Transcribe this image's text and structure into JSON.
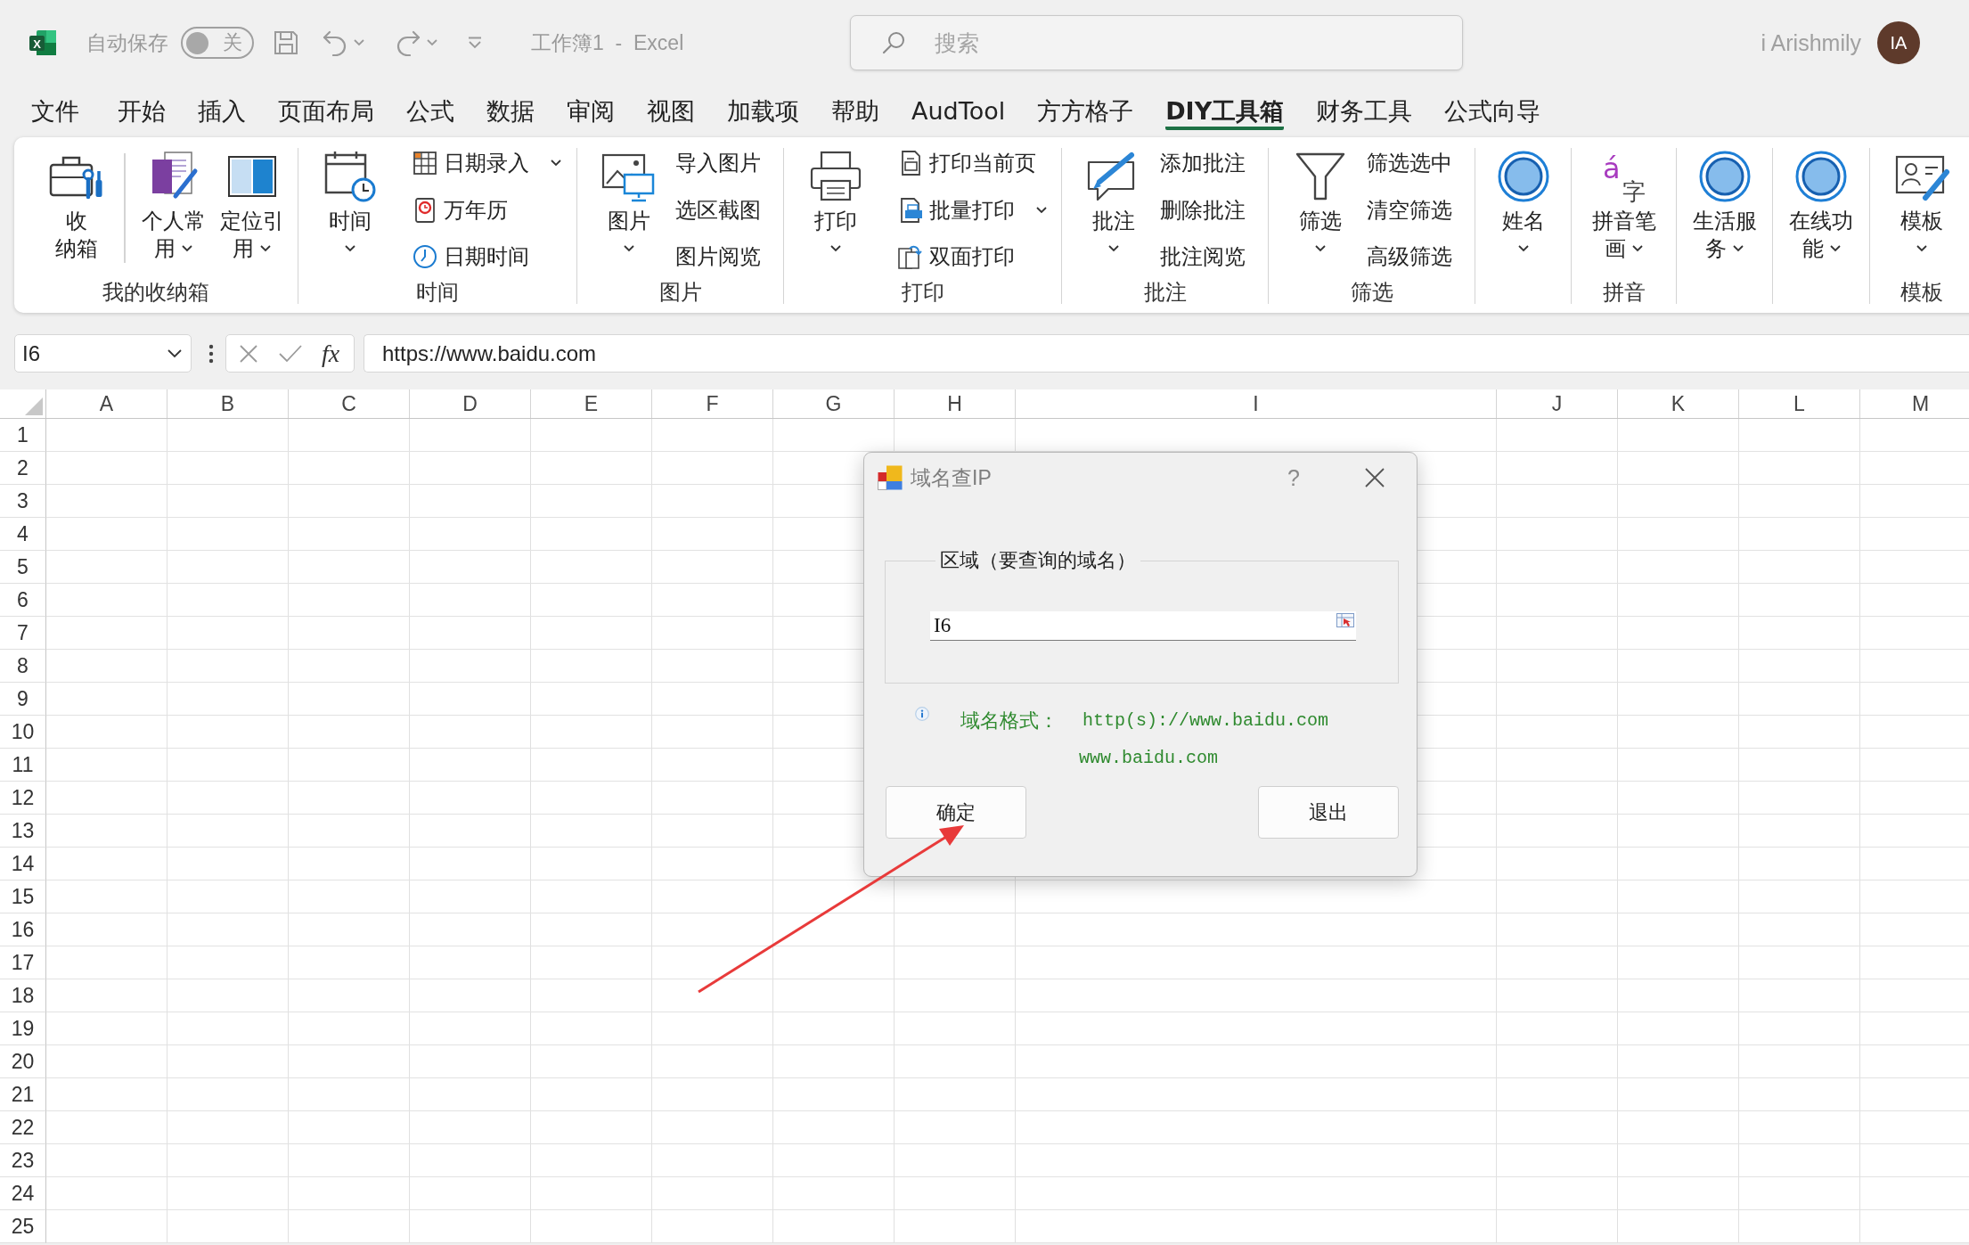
{
  "title_bar": {
    "logo_letter": "X",
    "autosave_label": "自动保存",
    "autosave_toggle": {
      "on": false,
      "label": "关"
    },
    "document_title": "工作簿1  -  Excel",
    "search": {
      "placeholder": "搜索"
    },
    "user_name": "i Arishmily",
    "avatar_initials": "IA"
  },
  "tabs": [
    {
      "label": "文件",
      "selected": false
    },
    {
      "label": "开始",
      "selected": false
    },
    {
      "label": "插入",
      "selected": false
    },
    {
      "label": "页面布局",
      "selected": false
    },
    {
      "label": "公式",
      "selected": false
    },
    {
      "label": "数据",
      "selected": false
    },
    {
      "label": "审阅",
      "selected": false
    },
    {
      "label": "视图",
      "selected": false
    },
    {
      "label": "加载项",
      "selected": false
    },
    {
      "label": "帮助",
      "selected": false
    },
    {
      "label": "AudTool",
      "selected": false
    },
    {
      "label": "方方格子",
      "selected": false
    },
    {
      "label": "DIY工具箱",
      "selected": true
    },
    {
      "label": "财务工具",
      "selected": false
    },
    {
      "label": "公式向导",
      "selected": false
    }
  ],
  "ribbon": {
    "groups": [
      {
        "label": "我的收纳箱",
        "items": [
          {
            "kind": "large",
            "lines": [
              "收",
              "纳箱"
            ],
            "dropdown": false
          },
          {
            "kind": "separator"
          },
          {
            "kind": "large",
            "lines": [
              "个人常",
              "用"
            ],
            "dropdown": true
          },
          {
            "kind": "large",
            "lines": [
              "定位引",
              "用"
            ],
            "dropdown": true
          }
        ]
      },
      {
        "label": "时间",
        "items": [
          {
            "kind": "large",
            "lines": [
              "时间"
            ],
            "dropdown": true
          },
          {
            "kind": "stack",
            "buttons": [
              {
                "label": "日期录入",
                "dropdown": true
              },
              {
                "label": "万年历",
                "dropdown": false
              },
              {
                "label": "日期时间",
                "dropdown": false
              }
            ]
          }
        ]
      },
      {
        "label": "图片",
        "items": [
          {
            "kind": "large",
            "lines": [
              "图片"
            ],
            "dropdown": true
          },
          {
            "kind": "stack",
            "buttons": [
              {
                "label": "导入图片",
                "dropdown": false
              },
              {
                "label": "选区截图",
                "dropdown": false
              },
              {
                "label": "图片阅览",
                "dropdown": false
              }
            ]
          }
        ]
      },
      {
        "label": "打印",
        "items": [
          {
            "kind": "large",
            "lines": [
              "打印"
            ],
            "dropdown": true
          },
          {
            "kind": "stack",
            "buttons": [
              {
                "label": "打印当前页",
                "dropdown": false
              },
              {
                "label": "批量打印",
                "dropdown": true
              },
              {
                "label": "双面打印",
                "dropdown": false
              }
            ]
          }
        ]
      },
      {
        "label": "批注",
        "items": [
          {
            "kind": "large",
            "lines": [
              "批注"
            ],
            "dropdown": true
          },
          {
            "kind": "stack",
            "buttons": [
              {
                "label": "添加批注",
                "dropdown": false
              },
              {
                "label": "删除批注",
                "dropdown": false
              },
              {
                "label": "批注阅览",
                "dropdown": false
              }
            ]
          }
        ]
      },
      {
        "label": "筛选",
        "items": [
          {
            "kind": "large",
            "lines": [
              "筛选"
            ],
            "dropdown": true
          },
          {
            "kind": "stack",
            "buttons": [
              {
                "label": "筛选选中",
                "dropdown": false
              },
              {
                "label": "清空筛选",
                "dropdown": false
              },
              {
                "label": "高级筛选",
                "dropdown": false
              }
            ]
          }
        ]
      },
      {
        "items": [
          {
            "kind": "large",
            "lines": [
              "姓名"
            ],
            "dropdown": true
          }
        ]
      },
      {
        "label": "拼音",
        "items": [
          {
            "kind": "large",
            "lines": [
              "拼音笔",
              "画"
            ],
            "dropdown": true,
            "icon_glyphs": [
              "á",
              "字"
            ]
          }
        ]
      },
      {
        "items": [
          {
            "kind": "large",
            "lines": [
              "生活服",
              "务"
            ],
            "dropdown": true
          }
        ]
      },
      {
        "items": [
          {
            "kind": "large",
            "lines": [
              "在线功",
              "能"
            ],
            "dropdown": true
          }
        ]
      },
      {
        "label": "模板",
        "items": [
          {
            "kind": "large",
            "lines": [
              "模板"
            ],
            "dropdown": true
          }
        ]
      }
    ]
  },
  "formula_bar": {
    "name_box": "I6",
    "function_label": "fx",
    "formula": "https://www.baidu.com"
  },
  "sheet": {
    "columns": [
      "A",
      "B",
      "C",
      "D",
      "E",
      "F",
      "G",
      "H",
      "I",
      "J",
      "K",
      "L",
      "M"
    ],
    "rows": [
      "1",
      "2",
      "3",
      "4",
      "5",
      "6",
      "7",
      "8",
      "9",
      "10",
      "11",
      "12",
      "13",
      "14",
      "15",
      "16",
      "17",
      "18",
      "19",
      "20",
      "21",
      "22",
      "23",
      "24",
      "25"
    ]
  },
  "dialog": {
    "title": "域名查IP",
    "help": "?",
    "group_label": "区域（要查询的域名）",
    "input": {
      "value": "I6"
    },
    "hint_label": "域名格式：",
    "hint_lines": [
      "http(s)://www.baidu.com",
      "www.baidu.com"
    ],
    "buttons": [
      "确定",
      "退出"
    ]
  }
}
